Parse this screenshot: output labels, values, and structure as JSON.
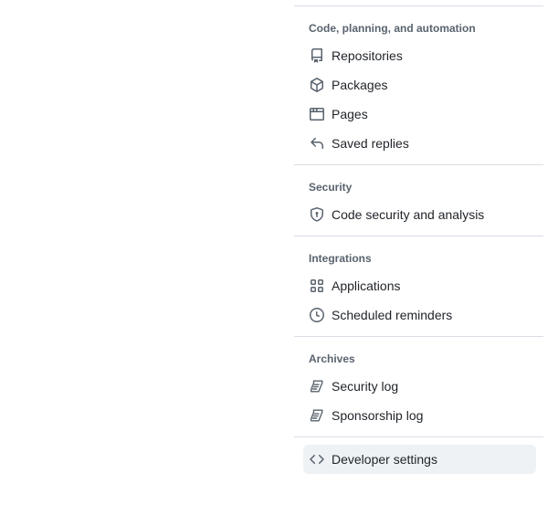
{
  "sections": [
    {
      "heading": "Code, planning, and automation",
      "items": [
        {
          "label": "Repositories",
          "icon": "repo-icon"
        },
        {
          "label": "Packages",
          "icon": "package-icon"
        },
        {
          "label": "Pages",
          "icon": "browser-icon"
        },
        {
          "label": "Saved replies",
          "icon": "reply-icon"
        }
      ]
    },
    {
      "heading": "Security",
      "items": [
        {
          "label": "Code security and analysis",
          "icon": "shield-lock-icon"
        }
      ]
    },
    {
      "heading": "Integrations",
      "items": [
        {
          "label": "Applications",
          "icon": "apps-icon"
        },
        {
          "label": "Scheduled reminders",
          "icon": "clock-icon"
        }
      ]
    },
    {
      "heading": "Archives",
      "items": [
        {
          "label": "Security log",
          "icon": "log-icon"
        },
        {
          "label": "Sponsorship log",
          "icon": "log-icon"
        }
      ]
    }
  ],
  "developer_settings": {
    "label": "Developer settings",
    "icon": "code-icon",
    "active": true
  },
  "colors": {
    "text": "#1f2328",
    "muted": "#59636e",
    "divider": "#d8dee4",
    "active_bg": "#eff2f5"
  }
}
